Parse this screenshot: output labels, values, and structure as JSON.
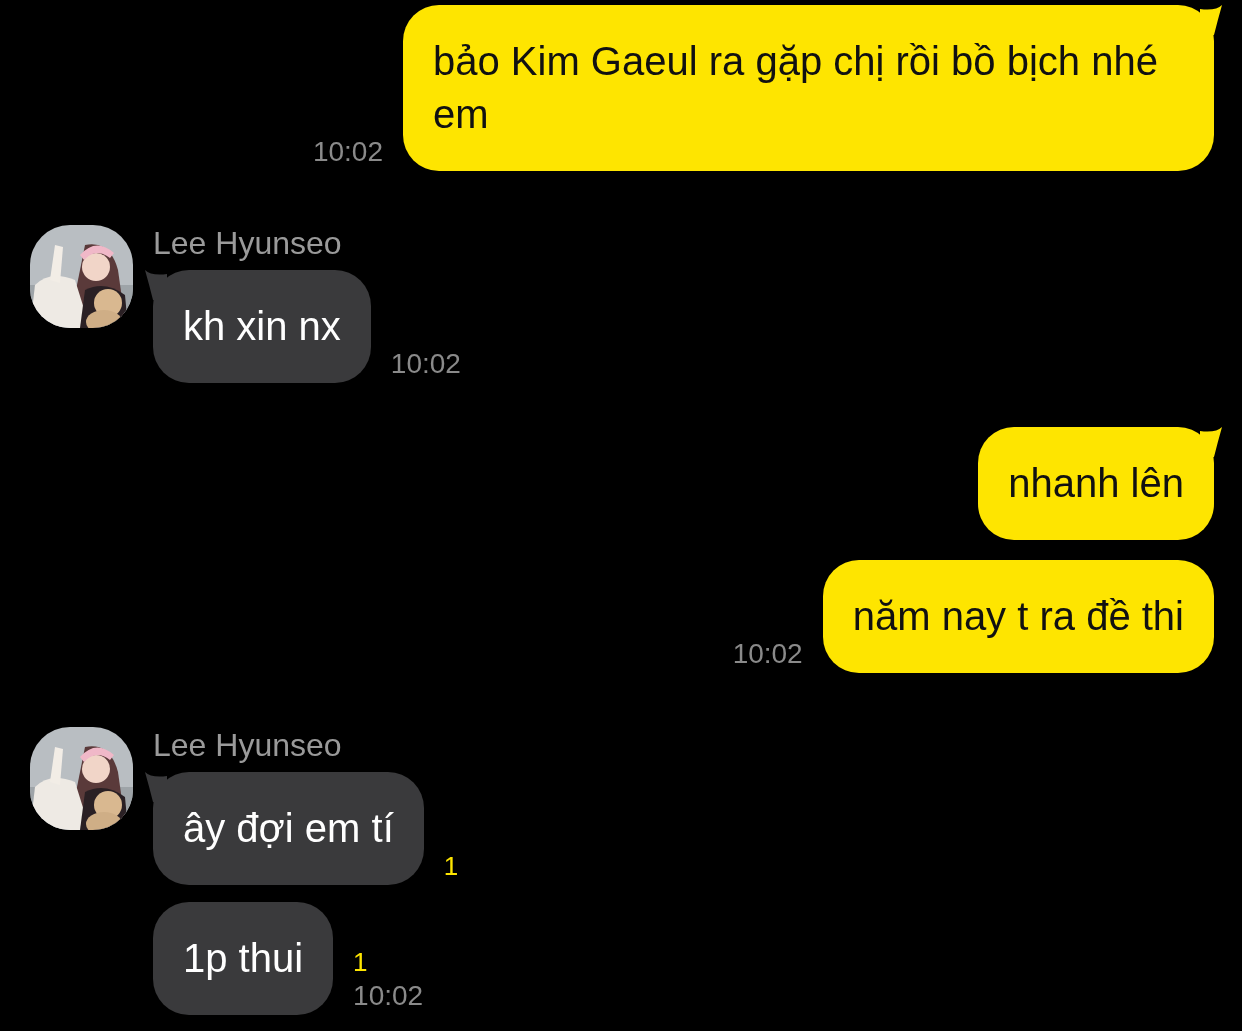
{
  "groups": [
    {
      "kind": "sent",
      "messages": [
        {
          "text": "bảo Kim Gaeul ra gặp chị rồi bồ bịch nhé em",
          "time": "10:02"
        }
      ]
    },
    {
      "kind": "received",
      "name": "Lee Hyunseo",
      "messages": [
        {
          "text": "kh xin nx",
          "time": "10:02"
        }
      ]
    },
    {
      "kind": "sent",
      "messages": [
        {
          "text": "nhanh lên"
        },
        {
          "text": "năm nay t ra đề thi",
          "time": "10:02"
        }
      ]
    },
    {
      "kind": "received",
      "name": "Lee Hyunseo",
      "messages": [
        {
          "text": "ây đợi em tí",
          "unread": "1"
        },
        {
          "text": "1p thui",
          "unread": "1",
          "time": "10:02"
        }
      ]
    }
  ]
}
